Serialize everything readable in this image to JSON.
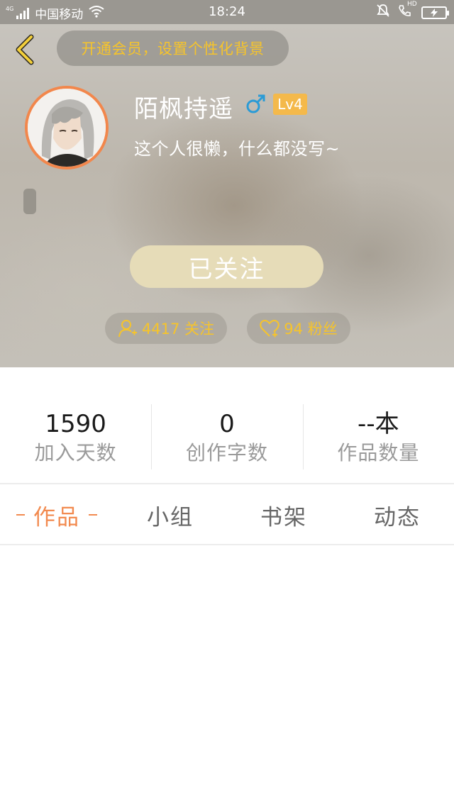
{
  "status_bar": {
    "network": "4G",
    "carrier": "中国移动",
    "time": "18:24",
    "hd_label": "HD"
  },
  "header": {
    "vip_banner": "开通会员，设置个性化背景",
    "username": "陌枫持遥",
    "gender": "male",
    "level": "Lv4",
    "bio": "这个人很懒，什么都没写~",
    "follow_button": "已关注",
    "following_chip": "4417 关注",
    "fans_chip": "94 粉丝"
  },
  "stats": [
    {
      "value": "1590",
      "label": "加入天数"
    },
    {
      "value": "0",
      "label": "创作字数"
    },
    {
      "value": "--本",
      "label": "作品数量"
    }
  ],
  "tabs": [
    {
      "label": "作品",
      "active": true
    },
    {
      "label": "小组",
      "active": false
    },
    {
      "label": "书架",
      "active": false
    },
    {
      "label": "动态",
      "active": false
    }
  ],
  "colors": {
    "accent_orange": "#f28a4f",
    "gold": "#f6c42b",
    "level_badge": "#f4b94b",
    "gender_blue": "#2a9bd6"
  }
}
